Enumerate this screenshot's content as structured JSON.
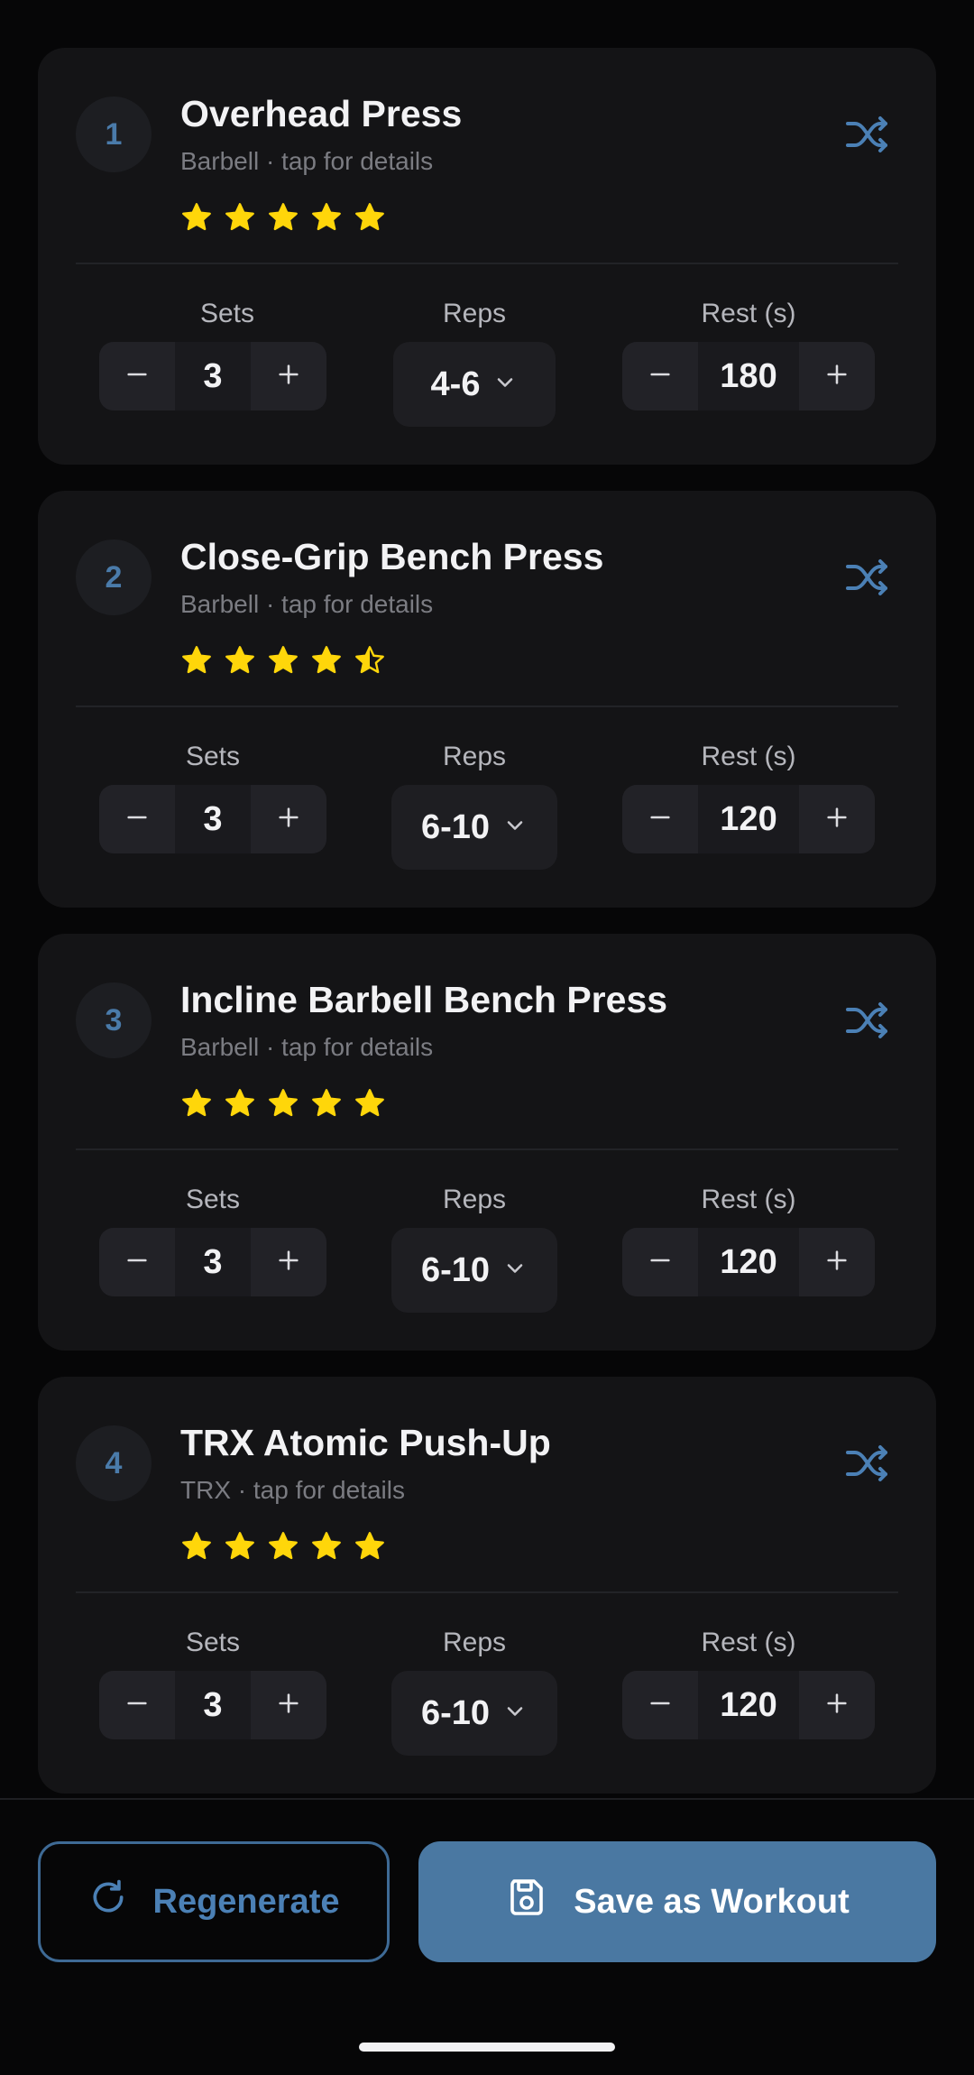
{
  "exercises": [
    {
      "number": "1",
      "name": "Overhead Press",
      "subtitle": "Barbell · tap for details",
      "rating": 5,
      "sets_label": "Sets",
      "sets": "3",
      "reps_label": "Reps",
      "reps": "4-6",
      "rest_label": "Rest (s)",
      "rest": "180"
    },
    {
      "number": "2",
      "name": "Close-Grip Bench Press",
      "subtitle": "Barbell · tap for details",
      "rating": 4.5,
      "sets_label": "Sets",
      "sets": "3",
      "reps_label": "Reps",
      "reps": "6-10",
      "rest_label": "Rest (s)",
      "rest": "120"
    },
    {
      "number": "3",
      "name": "Incline Barbell Bench Press",
      "subtitle": "Barbell · tap for details",
      "rating": 5,
      "sets_label": "Sets",
      "sets": "3",
      "reps_label": "Reps",
      "reps": "6-10",
      "rest_label": "Rest (s)",
      "rest": "120"
    },
    {
      "number": "4",
      "name": "TRX Atomic Push-Up",
      "subtitle": "TRX · tap for details",
      "rating": 5,
      "sets_label": "Sets",
      "sets": "3",
      "reps_label": "Reps",
      "reps": "6-10",
      "rest_label": "Rest (s)",
      "rest": "120"
    }
  ],
  "actions": {
    "regenerate_label": "Regenerate",
    "save_label": "Save as Workout"
  },
  "icons": {
    "shuffle": "shuffle-icon",
    "minus": "minus-icon",
    "plus": "plus-icon",
    "chevron": "chevron-down-icon",
    "regenerate": "refresh-icon",
    "save": "floppy-disk-icon",
    "star": "star-icon"
  },
  "colors": {
    "background": "#060607",
    "card": "#141416",
    "accent": "#4A78A2",
    "star": "#FFD60A",
    "text_primary": "#F2F2F4",
    "text_secondary": "#7B7C82"
  }
}
